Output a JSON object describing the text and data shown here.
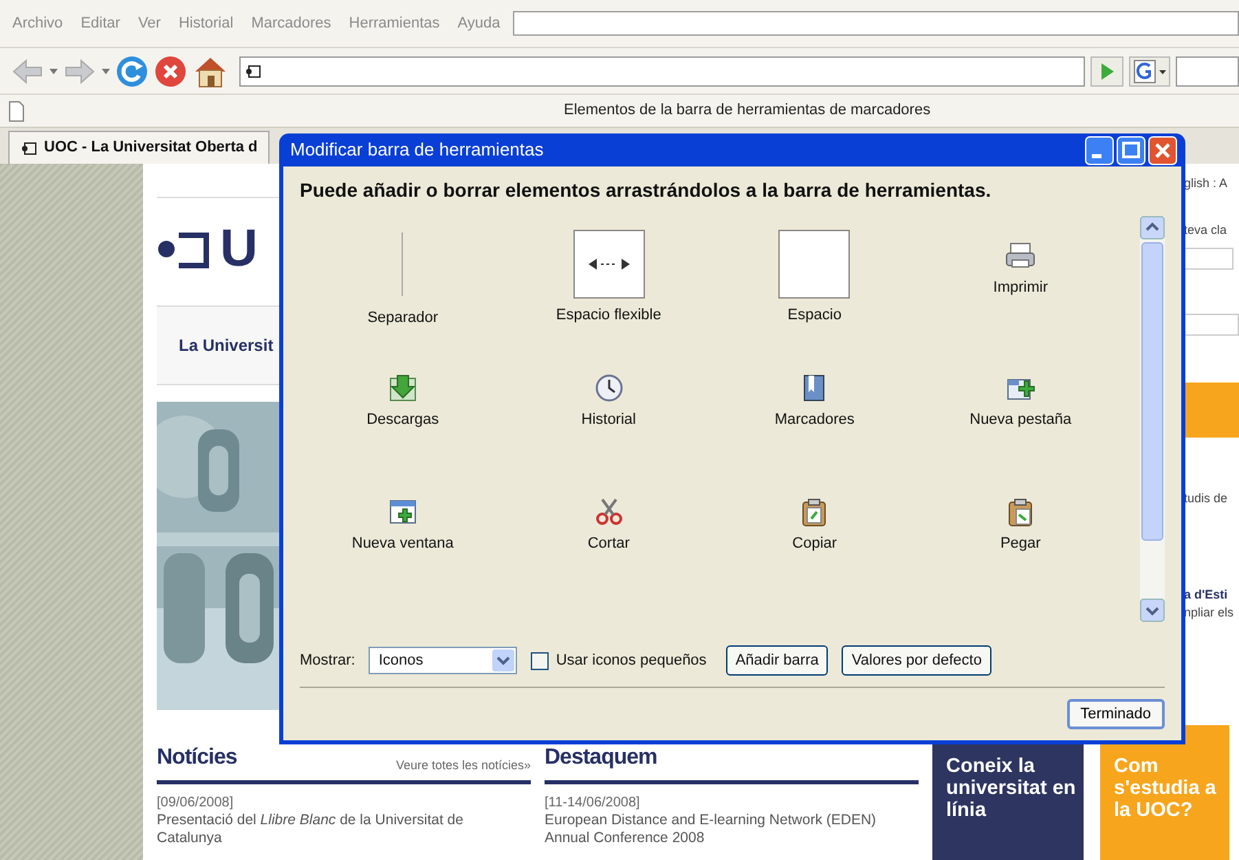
{
  "menu": [
    {
      "label": "Archivo"
    },
    {
      "label": "Editar"
    },
    {
      "label": "Ver"
    },
    {
      "label": "Historial"
    },
    {
      "label": "Marcadores"
    },
    {
      "label": "Herramientas"
    },
    {
      "label": "Ayuda"
    }
  ],
  "bookmarks_bar": {
    "label": "Elementos de la barra de herramientas de marcadores"
  },
  "tab": {
    "title": "UOC - La Universitat Oberta d"
  },
  "page": {
    "logo": "U",
    "nav_item": "La Universit",
    "right_top": [
      "glish : A",
      "teva cla"
    ],
    "right_mid": [
      "tudis de"
    ],
    "right_bold": "a d'Esti",
    "right_text": "npliar els",
    "news": {
      "title": "Notícies",
      "more": "Veure totes les notícies»",
      "date": "[09/06/2008]",
      "text": "Presentació del *Llibre Blanc* de la Universitat de Catalunya"
    },
    "featured": {
      "title": "Destaquem",
      "date": "[11-14/06/2008]",
      "text": "European Distance and E-learning Network (EDEN) Annual Conference 2008"
    },
    "promos": [
      {
        "text": "Coneix la universitat en línia",
        "color": "#2e3560"
      },
      {
        "text": "Com s'estudia a la UOC?",
        "color": "#f7a51c"
      }
    ]
  },
  "dialog": {
    "title": "Modificar barra de herramientas",
    "heading": "Puede añadir o borrar elementos arrastrándolos a la barra de herramientas.",
    "items": [
      {
        "kind": "separator",
        "label": "Separador"
      },
      {
        "kind": "flexible-space",
        "label": "Espacio flexible"
      },
      {
        "kind": "space",
        "label": "Espacio"
      },
      {
        "kind": "printer",
        "label": "Imprimir"
      },
      {
        "kind": "download",
        "label": "Descargas"
      },
      {
        "kind": "history",
        "label": "Historial"
      },
      {
        "kind": "bookmarks",
        "label": "Marcadores"
      },
      {
        "kind": "new-tab",
        "label": "Nueva pestaña"
      },
      {
        "kind": "new-window",
        "label": "Nueva ventana"
      },
      {
        "kind": "cut",
        "label": "Cortar"
      },
      {
        "kind": "copy",
        "label": "Copiar"
      },
      {
        "kind": "paste",
        "label": "Pegar"
      }
    ],
    "show_label": "Mostrar:",
    "show_value": "Iconos",
    "small_icons": {
      "label": "Usar iconos pequeños",
      "checked": false
    },
    "buttons": [
      "Añadir barra",
      "Valores por defecto"
    ],
    "done": "Terminado"
  }
}
